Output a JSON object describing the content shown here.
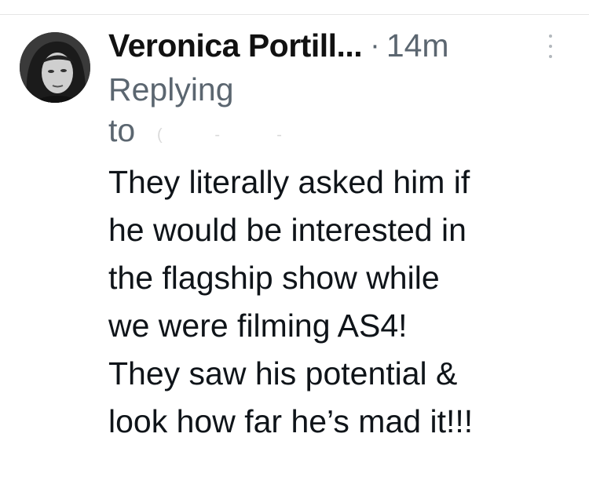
{
  "author": {
    "display_name": "Veronica Portill...",
    "separator": "·",
    "timestamp": "14m"
  },
  "reply": {
    "replying_label": "Replying",
    "to_label": "to"
  },
  "tweet": {
    "text": "They literally asked him if\nhe would be interested in\nthe flagship show while\nwe were filming AS4!\nThey saw his potential &\nlook how far he’s mad it!!!"
  },
  "icons": {
    "more": "more-vertical-icon"
  },
  "colors": {
    "text": "#0f1419",
    "muted": "#5b6670",
    "background": "#ffffff"
  }
}
